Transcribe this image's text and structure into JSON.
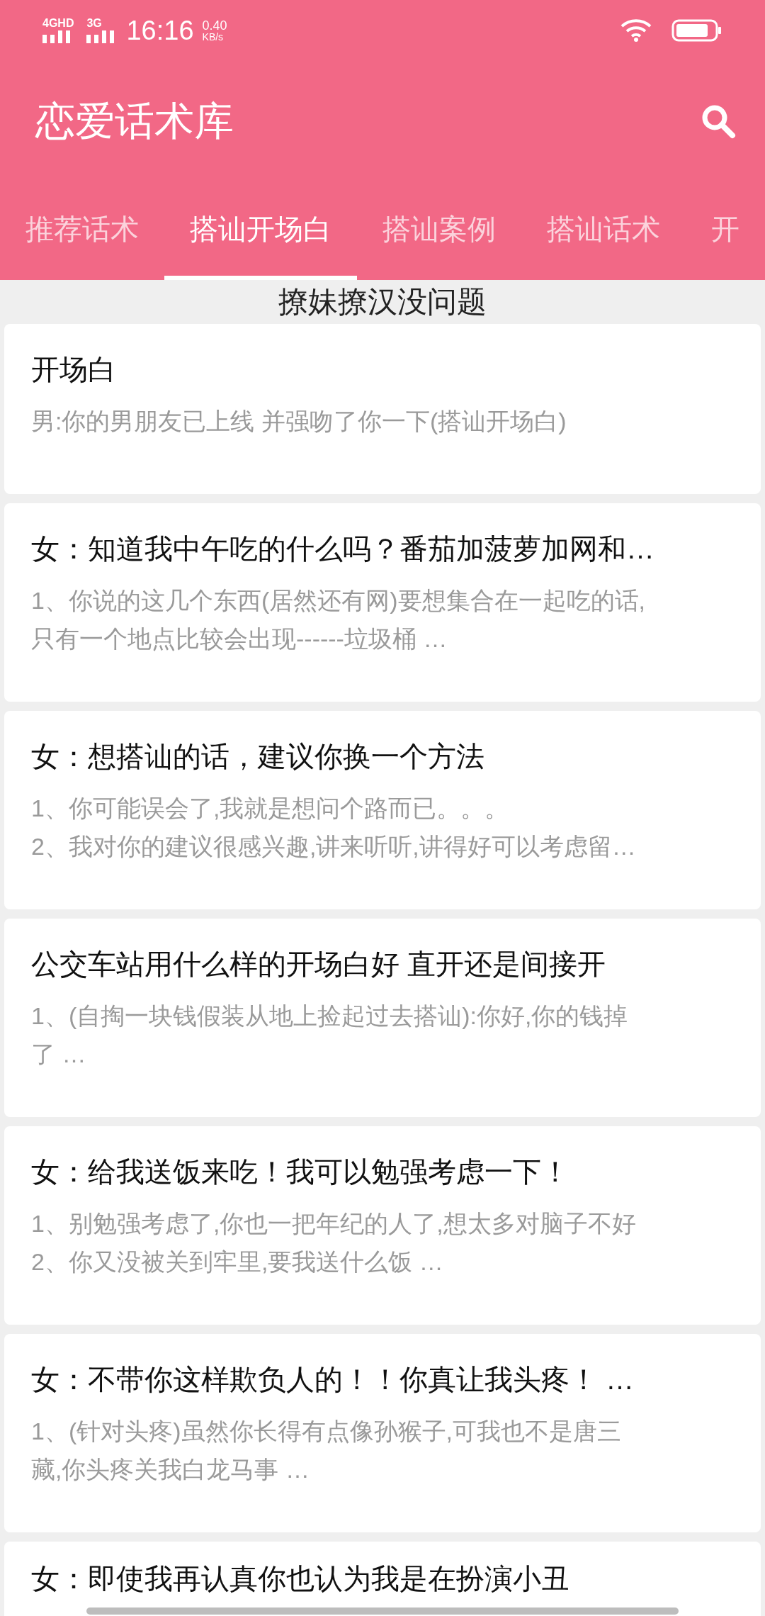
{
  "status_bar": {
    "network_1": "4GHD",
    "network_2": "3G",
    "time": "16:16",
    "speed": "0.40",
    "speed_unit": "KB/s"
  },
  "app_bar": {
    "title": "恋爱话术库"
  },
  "tabs": [
    {
      "label": "推荐话术",
      "selected": false
    },
    {
      "label": "搭讪开场白",
      "selected": true
    },
    {
      "label": "搭讪案例",
      "selected": false
    },
    {
      "label": "搭讪话术",
      "selected": false
    },
    {
      "label": "开",
      "selected": false
    }
  ],
  "subtitle": "撩妹撩汉没问题",
  "cards": [
    {
      "title": "开场白",
      "lines": [
        "男:你的男朋友已上线 并强吻了你一下(搭讪开场白)"
      ]
    },
    {
      "title": "女：知道我中午吃的什么吗？番茄加菠萝加网和…",
      "lines": [
        "1、你说的这几个东西(居然还有网)要想集合在一起吃的话,",
        "只有一个地点比较会出现------垃圾桶 …"
      ]
    },
    {
      "title": "女：想搭讪的话，建议你换一个方法",
      "lines": [
        "1、你可能误会了,我就是想问个路而已。。。",
        "2、我对你的建议很感兴趣,讲来听听,讲得好可以考虑留…"
      ]
    },
    {
      "title": "公交车站用什么样的开场白好 直开还是间接开",
      "lines": [
        "1、(自掏一块钱假装从地上捡起过去搭讪):你好,你的钱掉",
        "了 …"
      ]
    },
    {
      "title": "女：给我送饭来吃！我可以勉强考虑一下！",
      "lines": [
        "1、别勉强考虑了,你也一把年纪的人了,想太多对脑子不好",
        "2、你又没被关到牢里,要我送什么饭 …"
      ]
    },
    {
      "title": "女：不带你这样欺负人的！！你真让我头疼！ …",
      "lines": [
        "1、(针对头疼)虽然你长得有点像孙猴子,可我也不是唐三",
        "藏,你头疼关我白龙马事 …"
      ]
    },
    {
      "title": "女：即使我再认真你也认为我是在扮演小丑"
    }
  ]
}
